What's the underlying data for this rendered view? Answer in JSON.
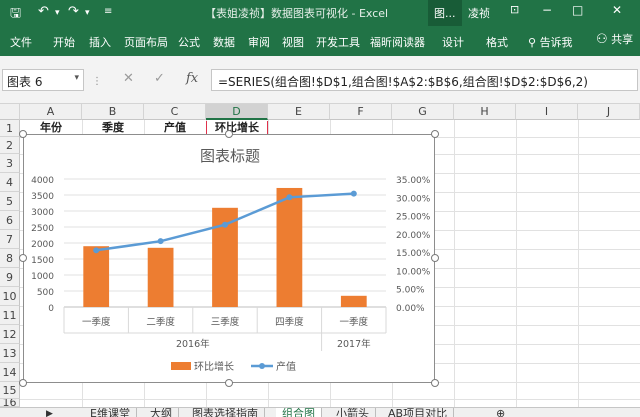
{
  "app": {
    "window_title": "【表姐凌祯】数据图表可视化 - Excel",
    "context_tabs": [
      "图...",
      "凌祯"
    ],
    "window_controls": [
      "−",
      "□",
      "✕"
    ]
  },
  "ribbon": {
    "tabs": [
      "文件",
      "开始",
      "插入",
      "页面布局",
      "公式",
      "数据",
      "审阅",
      "视图",
      "开发工具",
      "福昕阅读器",
      "设计",
      "格式"
    ],
    "tell_me": "告诉我",
    "share": "共享"
  },
  "formula_bar": {
    "name_box": "图表 6",
    "cancel_icon": "✕",
    "enter_icon": "✓",
    "fx_label": "fx",
    "formula": "=SERIES(组合图!$D$1,组合图!$A$2:$B$6,组合图!$D$2:$D$6,2)"
  },
  "grid": {
    "columns": [
      "A",
      "B",
      "C",
      "D",
      "E",
      "F",
      "G",
      "H",
      "I",
      "J"
    ],
    "rows": [
      "1",
      "2",
      "3",
      "4",
      "5",
      "6",
      "7",
      "8",
      "9",
      "10",
      "11",
      "12",
      "13",
      "14",
      "15",
      "16"
    ],
    "row1_cells": [
      "年份",
      "季度",
      "产值",
      "环比增长"
    ]
  },
  "sheet_tabs": [
    "E维课堂",
    "大纲",
    "图表选择指南",
    "组合图",
    "小箭头",
    "AB项目对比"
  ],
  "colors": {
    "brand": "#217346",
    "bar": "#ED7D31",
    "line": "#5B9BD5"
  },
  "chart_data": {
    "type": "bar",
    "title": "图表标题",
    "categories": [
      "一季度",
      "二季度",
      "三季度",
      "四季度",
      "一季度"
    ],
    "groups": [
      {
        "label": "2016年",
        "span": 4
      },
      {
        "label": "2017年",
        "span": 1
      }
    ],
    "series": [
      {
        "name": "环比增长",
        "type": "bar",
        "axis": "left",
        "values": [
          1900,
          1850,
          3100,
          3720,
          350
        ]
      },
      {
        "name": "产值",
        "type": "line",
        "axis": "right",
        "values": [
          0.155,
          0.18,
          0.225,
          0.3,
          0.31
        ]
      }
    ],
    "y_left": {
      "ticks": [
        "0",
        "500",
        "1000",
        "1500",
        "2000",
        "2500",
        "3000",
        "3500",
        "4000"
      ],
      "range": [
        0,
        4000
      ]
    },
    "y_right": {
      "ticks": [
        "0.00%",
        "5.00%",
        "10.00%",
        "15.00%",
        "20.00%",
        "25.00%",
        "30.00%",
        "35.00%"
      ],
      "range": [
        0,
        0.35
      ]
    },
    "legend_position": "bottom",
    "grid": true
  }
}
